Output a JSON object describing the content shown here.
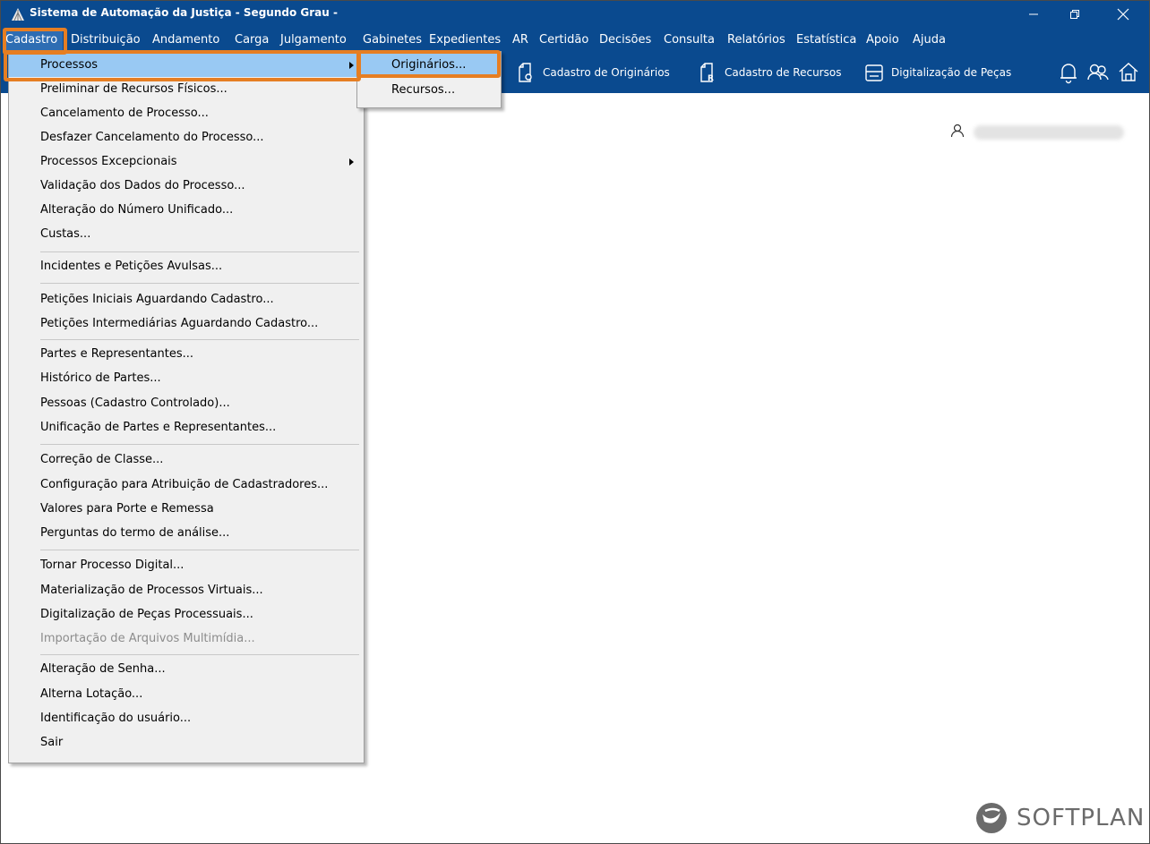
{
  "window": {
    "title": "Sistema de Automação da Justiça - Segundo Grau -",
    "min_glyph": "—",
    "restore_glyph": "❐",
    "close_glyph": "✕"
  },
  "menubar": {
    "items": [
      "Cadastro",
      "Distribuição",
      "Andamento",
      "Carga",
      "Julgamento",
      "Gabinetes",
      "Expedientes",
      "AR",
      "Certidão",
      "Decisões",
      "Consulta",
      "Relatórios",
      "Estatística",
      "Apoio",
      "Ajuda"
    ]
  },
  "toolbar": {
    "cadastro_originarios": "Cadastro de Originários",
    "cadastro_recursos": "Cadastro de Recursos",
    "digitalizacao_pecas": "Digitalização de Peças"
  },
  "dropdown": {
    "items": [
      "Processos",
      "Preliminar de Recursos Físicos...",
      "Cancelamento de Processo...",
      "Desfazer Cancelamento do Processo...",
      "Processos Excepcionais",
      "Validação dos Dados do Processo...",
      "Alteração do Número Unificado...",
      "Custas...",
      "Incidentes e Petições Avulsas...",
      "Petições Iniciais Aguardando Cadastro...",
      "Petições Intermediárias Aguardando Cadastro...",
      "Partes e Representantes...",
      "Histórico de Partes...",
      "Pessoas (Cadastro Controlado)...",
      "Unificação de Partes e Representantes...",
      "Correção de Classe...",
      "Configuração para Atribuição de Cadastradores...",
      "Valores para Porte e Remessa",
      "Perguntas do termo de análise...",
      "Tornar Processo Digital...",
      "Materialização de Processos Virtuais...",
      "Digitalização de Peças Processuais...",
      "Importação de Arquivos Multimídia...",
      "Alteração de Senha...",
      "Alterna Lotação...",
      "Identificação do usuário...",
      "Sair"
    ]
  },
  "submenu": {
    "items": [
      "Originários...",
      "Recursos..."
    ]
  },
  "brand": {
    "logo_text": "SOFTPLAN"
  },
  "colors": {
    "title_bar": "#0a4a8f",
    "menu_highlight": "#99c9f3",
    "annotation_orange": "#e67e22"
  }
}
